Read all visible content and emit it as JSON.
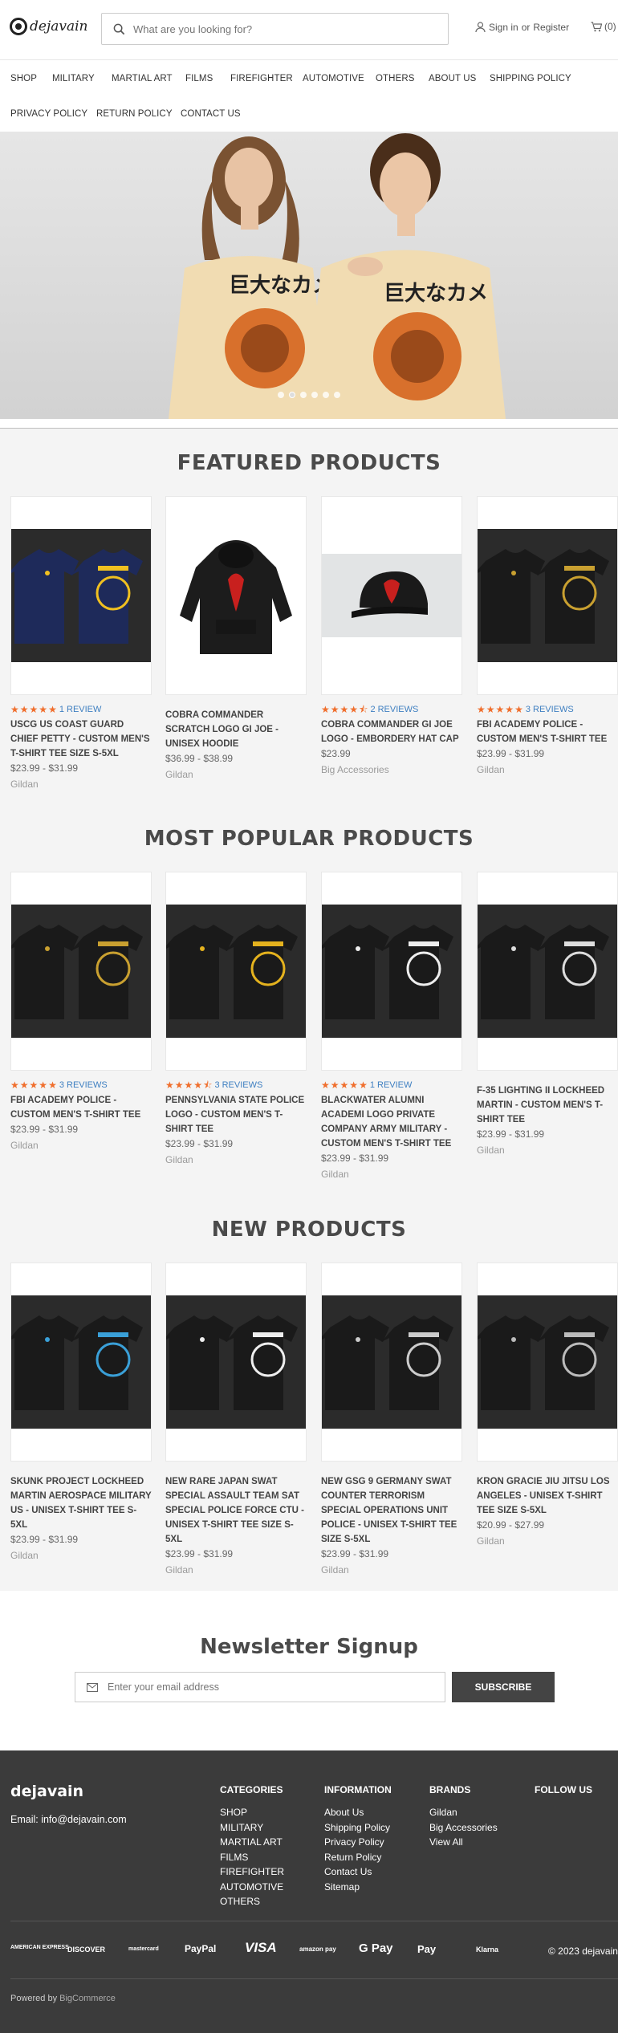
{
  "header": {
    "logo_text": "dejavain",
    "search_placeholder": "What are you looking for?",
    "sign_in": "Sign in",
    "or": "or",
    "register": "Register",
    "cart_count": "(0)"
  },
  "nav": {
    "row1": [
      "Shop",
      "Military",
      "Martial Art",
      "Films",
      "Firefighter",
      "Automotive",
      "Others",
      "About Us",
      "Shipping Policy"
    ],
    "row2": [
      "Privacy Policy",
      "Return Policy",
      "Contact Us"
    ]
  },
  "hero": {
    "slide_count": 6,
    "active_slide": 2
  },
  "sections": [
    {
      "title": "FEATURED PRODUCTS",
      "products": [
        {
          "name": "USCG US COAST GUARD CHIEF PETTY - CUSTOM MEN'S T-SHIRT TEE SIZE S-5XL",
          "price": "$23.99 - $31.99",
          "brand": "Gildan",
          "rating": 5,
          "reviews": "1 REVIEW",
          "image": "navy-tees"
        },
        {
          "name": "COBRA COMMANDER SCRATCH LOGO GI JOE - UNISEX HOODIE",
          "price": "$36.99 - $38.99",
          "brand": "Gildan",
          "rating": 0,
          "reviews": "",
          "image": "hoodie"
        },
        {
          "name": "COBRA COMMANDER GI JOE LOGO - EMBORDERY HAT CAP",
          "price": "$23.99",
          "brand": "Big Accessories",
          "rating": 4.5,
          "reviews": "2 REVIEWS",
          "image": "cap"
        },
        {
          "name": "FBI ACADEMY POLICE - CUSTOM MEN'S T-SHIRT TEE",
          "price": "$23.99 - $31.99",
          "brand": "Gildan",
          "rating": 5,
          "reviews": "3 REVIEWS",
          "image": "black-tees"
        }
      ]
    },
    {
      "title": "MOST POPULAR PRODUCTS",
      "products": [
        {
          "name": "FBI ACADEMY POLICE - CUSTOM MEN'S T-SHIRT TEE",
          "price": "$23.99 - $31.99",
          "brand": "Gildan",
          "rating": 5,
          "reviews": "3 REVIEWS",
          "image": "black-tees"
        },
        {
          "name": "PENNSYLVANIA STATE POLICE LOGO - CUSTOM MEN'S T-SHIRT TEE",
          "price": "$23.99 - $31.99",
          "brand": "Gildan",
          "rating": 4.5,
          "reviews": "3 REVIEWS",
          "image": "black-tees-gold"
        },
        {
          "name": "BLACKWATER ALUMNI ACADEMI LOGO PRIVATE COMPANY ARMY MILITARY - CUSTOM MEN'S T-SHIRT TEE",
          "price": "$23.99 - $31.99",
          "brand": "Gildan",
          "rating": 5,
          "reviews": "1 REVIEW",
          "image": "black-tees-white"
        },
        {
          "name": "F-35 LIGHTING II LOCKHEED MARTIN - CUSTOM MEN'S T-SHIRT TEE",
          "price": "$23.99 - $31.99",
          "brand": "Gildan",
          "rating": 0,
          "reviews": "",
          "image": "black-tees-plane"
        }
      ]
    },
    {
      "title": "NEW PRODUCTS",
      "products": [
        {
          "name": "SKUNK PROJECT LOCKHEED MARTIN AEROSPACE MILITARY US - UNISEX T-SHIRT TEE S-5XL",
          "price": "$23.99 - $31.99",
          "brand": "Gildan",
          "rating": 0,
          "reviews": "",
          "image": "black-tees-blue"
        },
        {
          "name": "NEW RARE JAPAN SWAT SPECIAL ASSAULT TEAM SAT SPECIAL POLICE FORCE CTU - UNISEX T-SHIRT TEE SIZE S-5XL",
          "price": "$23.99 - $31.99",
          "brand": "Gildan",
          "rating": 0,
          "reviews": "",
          "image": "black-tees-sat"
        },
        {
          "name": "NEW GSG 9 GERMANY SWAT COUNTER TERRORISM SPECIAL OPERATIONS UNIT POLICE - UNISEX T-SHIRT TEE SIZE S-5XL",
          "price": "$23.99 - $31.99",
          "brand": "Gildan",
          "rating": 0,
          "reviews": "",
          "image": "black-tees-gsg"
        },
        {
          "name": "KRON GRACIE JIU JITSU LOS ANGELES - UNISEX T-SHIRT TEE SIZE S-5XL",
          "price": "$20.99 - $27.99",
          "brand": "Gildan",
          "rating": 0,
          "reviews": "",
          "image": "black-tees-kron"
        }
      ]
    }
  ],
  "newsletter": {
    "title": "Newsletter Signup",
    "placeholder": "Enter your email address",
    "button": "Subscribe"
  },
  "footer": {
    "brand": "dejavain",
    "email": "Email: info@dejavain.com",
    "columns": [
      {
        "title": "Categories",
        "links": [
          "SHOP",
          "MILITARY",
          "MARTIAL ART",
          "FILMS",
          "FIREFIGHTER",
          "AUTOMOTIVE",
          "OTHERS"
        ]
      },
      {
        "title": "Information",
        "links": [
          "About Us",
          "Shipping Policy",
          "Privacy Policy",
          "Return Policy",
          "Contact Us",
          "Sitemap"
        ]
      },
      {
        "title": "Brands",
        "links": [
          "Gildan",
          "Big Accessories",
          "View All"
        ]
      },
      {
        "title": "Follow Us",
        "links": []
      }
    ],
    "payments": [
      "AMERICAN EXPRESS",
      "DISCOVER",
      "mastercard",
      "PayPal",
      "VISA",
      "amazon pay",
      "G Pay",
      "Pay",
      "Klarna"
    ],
    "copyright": "© 2023 dejavain",
    "powered_by": "Powered by",
    "platform": "BigCommerce"
  },
  "colors": {
    "star": "#f06e2c",
    "review_link": "#3e7fc1",
    "footer_bg": "#3b3b3b",
    "button": "#444444"
  }
}
